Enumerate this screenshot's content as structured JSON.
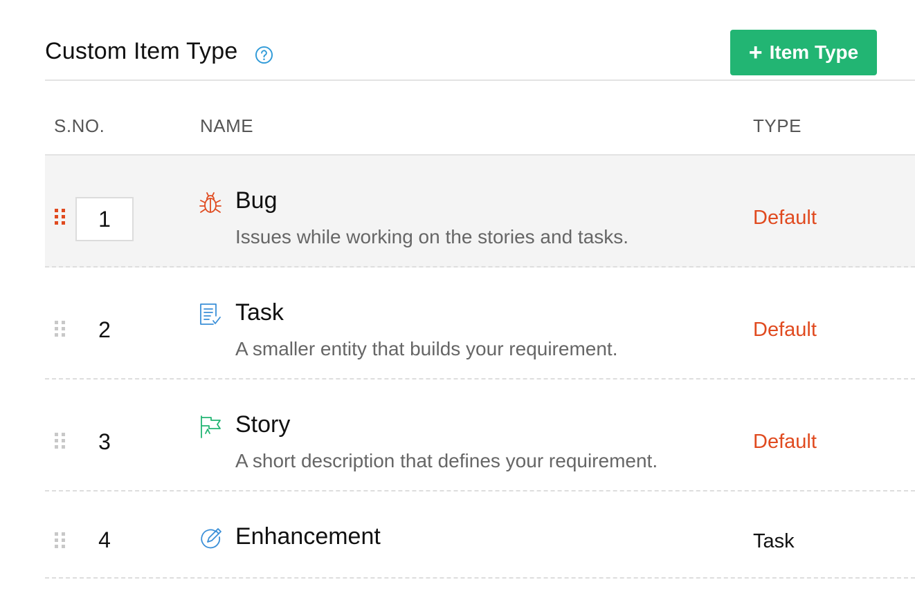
{
  "header": {
    "title": "Custom Item Type",
    "help_icon": "question-circle-icon",
    "add_button_label": "Item Type",
    "add_button_icon": "plus-icon",
    "accent_color": "#22b573"
  },
  "table": {
    "columns": [
      "S.NO.",
      "NAME",
      "TYPE"
    ],
    "rows": [
      {
        "sno": "1",
        "icon": "bug-icon",
        "name": "Bug",
        "description": "Issues while working on the stories and tasks.",
        "type": "Default"
      },
      {
        "sno": "2",
        "icon": "task-checklist-icon",
        "name": "Task",
        "description": "A smaller entity that builds your requirement.",
        "type": "Default"
      },
      {
        "sno": "3",
        "icon": "story-flag-icon",
        "name": "Story",
        "description": "A short description that defines your requirement.",
        "type": "Default"
      },
      {
        "sno": "4",
        "icon": "enhancement-pencil-icon",
        "name": "Enhancement",
        "description": "",
        "type": "Task"
      }
    ]
  },
  "colors": {
    "default_type": "#e04a1f",
    "bug_icon": "#e04a1f",
    "task_icon": "#3a8fd8",
    "story_icon": "#22b573",
    "enhancement_icon": "#3a8fd8"
  }
}
